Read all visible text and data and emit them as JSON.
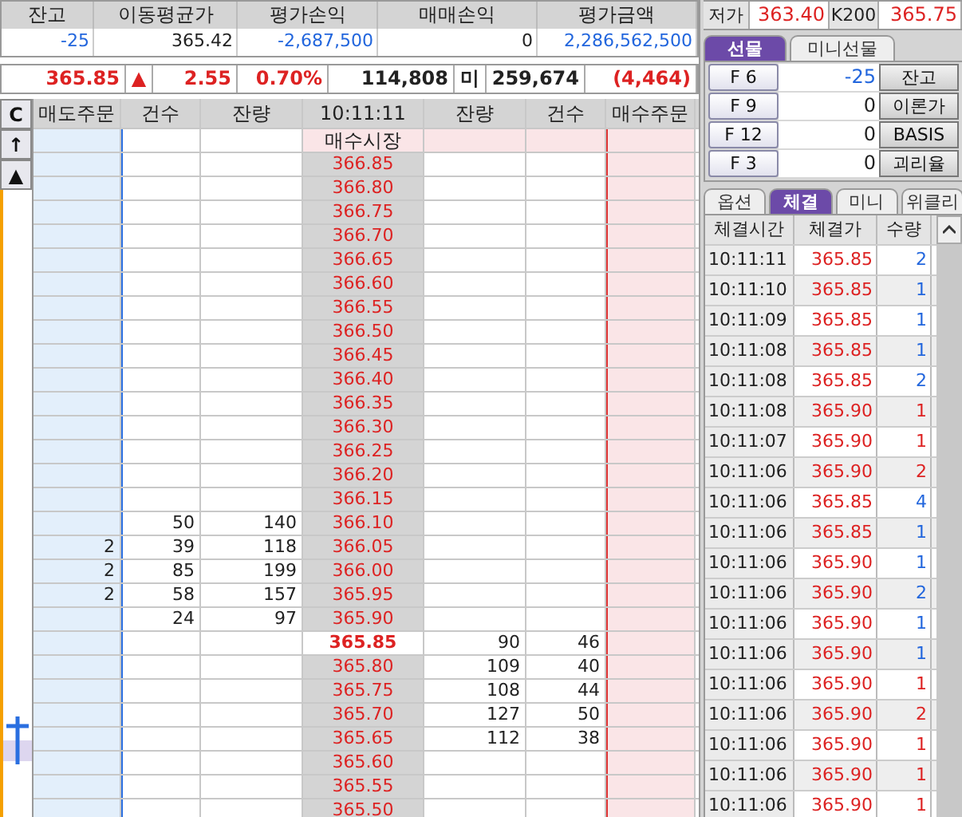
{
  "balance": {
    "columns": [
      "잔고",
      "이동평균가",
      "평가손익",
      "매매손익",
      "평가금액"
    ],
    "values": [
      "-25",
      "365.42",
      "-2,687,500",
      "0",
      "2,286,562,500"
    ]
  },
  "ticker": {
    "price": "365.85",
    "arrow": "▲",
    "change": "2.55",
    "rate": "0.70%",
    "volume": "114,808",
    "oi_label": "미",
    "open_interest": "259,674",
    "oi_change": "(4,464)"
  },
  "side_buttons": [
    "C",
    "↑",
    "▲"
  ],
  "book": {
    "columns": [
      "매도주문",
      "건수",
      "잔량",
      "10:11:11",
      "잔량",
      "건수",
      "매수주문"
    ],
    "market_label": "매수시장",
    "rows": [
      {
        "price": "366.85",
        "current": false
      },
      {
        "price": "366.80",
        "current": false
      },
      {
        "price": "366.75",
        "current": false
      },
      {
        "price": "366.70",
        "current": false
      },
      {
        "price": "366.65",
        "current": false
      },
      {
        "price": "366.60",
        "current": false
      },
      {
        "price": "366.55",
        "current": false
      },
      {
        "price": "366.50",
        "current": false
      },
      {
        "price": "366.45",
        "current": false
      },
      {
        "price": "366.40",
        "current": false
      },
      {
        "price": "366.35",
        "current": false
      },
      {
        "price": "366.30",
        "current": false
      },
      {
        "price": "366.25",
        "current": false
      },
      {
        "price": "366.20",
        "current": false
      },
      {
        "price": "366.15",
        "current": false
      },
      {
        "price": "366.10",
        "ask_count": "50",
        "ask_qty": "140",
        "current": false
      },
      {
        "price": "366.05",
        "ask_order": "2",
        "ask_count": "39",
        "ask_qty": "118",
        "current": false
      },
      {
        "price": "366.00",
        "ask_order": "2",
        "ask_count": "85",
        "ask_qty": "199",
        "current": false
      },
      {
        "price": "365.95",
        "ask_order": "2",
        "ask_count": "58",
        "ask_qty": "157",
        "current": false
      },
      {
        "price": "365.90",
        "ask_count": "24",
        "ask_qty": "97",
        "current": false
      },
      {
        "price": "365.85",
        "bid_qty": "90",
        "bid_count": "46",
        "current": true
      },
      {
        "price": "365.80",
        "bid_qty": "109",
        "bid_count": "40",
        "current": false
      },
      {
        "price": "365.75",
        "bid_qty": "108",
        "bid_count": "44",
        "current": false
      },
      {
        "price": "365.70",
        "bid_qty": "127",
        "bid_count": "50",
        "current": false
      },
      {
        "price": "365.65",
        "bid_qty": "112",
        "bid_count": "38",
        "current": false
      },
      {
        "price": "365.60",
        "current": false
      },
      {
        "price": "365.55",
        "current": false
      },
      {
        "price": "365.50",
        "current": false
      }
    ]
  },
  "quote": {
    "low_label": "저가",
    "low": "363.40",
    "index_label": "K200",
    "index": "365.75"
  },
  "product_tabs": [
    {
      "label": "선물",
      "selected": true
    },
    {
      "label": "미니선물",
      "selected": false
    }
  ],
  "futures": [
    {
      "code": "F 6",
      "value": "-25",
      "action": "잔고",
      "negative": true
    },
    {
      "code": "F 9",
      "value": "0",
      "action": "이론가",
      "negative": false
    },
    {
      "code": "F 12",
      "value": "0",
      "action": "BASIS",
      "negative": false
    },
    {
      "code": "F 3",
      "value": "0",
      "action": "괴리율",
      "negative": false
    }
  ],
  "trade_tabs": [
    {
      "label": "옵션",
      "selected": false
    },
    {
      "label": "체결",
      "selected": true
    },
    {
      "label": "미니",
      "selected": false
    },
    {
      "label": "위클리",
      "selected": false
    }
  ],
  "trades": {
    "columns": [
      "체결시간",
      "체결가",
      "수량"
    ],
    "rows": [
      {
        "time": "10:11:11",
        "price": "365.85",
        "qty": "2",
        "color": "#2266dd"
      },
      {
        "time": "10:11:10",
        "price": "365.85",
        "qty": "1",
        "color": "#2266dd"
      },
      {
        "time": "10:11:09",
        "price": "365.85",
        "qty": "1",
        "color": "#2266dd"
      },
      {
        "time": "10:11:08",
        "price": "365.85",
        "qty": "1",
        "color": "#2266dd"
      },
      {
        "time": "10:11:08",
        "price": "365.85",
        "qty": "2",
        "color": "#2266dd"
      },
      {
        "time": "10:11:08",
        "price": "365.90",
        "qty": "1",
        "color": "#dd2222"
      },
      {
        "time": "10:11:07",
        "price": "365.90",
        "qty": "1",
        "color": "#dd2222"
      },
      {
        "time": "10:11:06",
        "price": "365.90",
        "qty": "2",
        "color": "#dd2222"
      },
      {
        "time": "10:11:06",
        "price": "365.85",
        "qty": "4",
        "color": "#2266dd"
      },
      {
        "time": "10:11:06",
        "price": "365.85",
        "qty": "1",
        "color": "#2266dd"
      },
      {
        "time": "10:11:06",
        "price": "365.90",
        "qty": "1",
        "color": "#2266dd"
      },
      {
        "time": "10:11:06",
        "price": "365.90",
        "qty": "2",
        "color": "#2266dd"
      },
      {
        "time": "10:11:06",
        "price": "365.90",
        "qty": "1",
        "color": "#2266dd"
      },
      {
        "time": "10:11:06",
        "price": "365.90",
        "qty": "1",
        "color": "#2266dd"
      },
      {
        "time": "10:11:06",
        "price": "365.90",
        "qty": "1",
        "color": "#dd2222"
      },
      {
        "time": "10:11:06",
        "price": "365.90",
        "qty": "2",
        "color": "#dd2222"
      },
      {
        "time": "10:11:06",
        "price": "365.90",
        "qty": "1",
        "color": "#dd2222"
      },
      {
        "time": "10:11:06",
        "price": "365.90",
        "qty": "1",
        "color": "#dd2222"
      },
      {
        "time": "10:11:06",
        "price": "365.90",
        "qty": "1",
        "color": "#dd2222"
      }
    ]
  }
}
